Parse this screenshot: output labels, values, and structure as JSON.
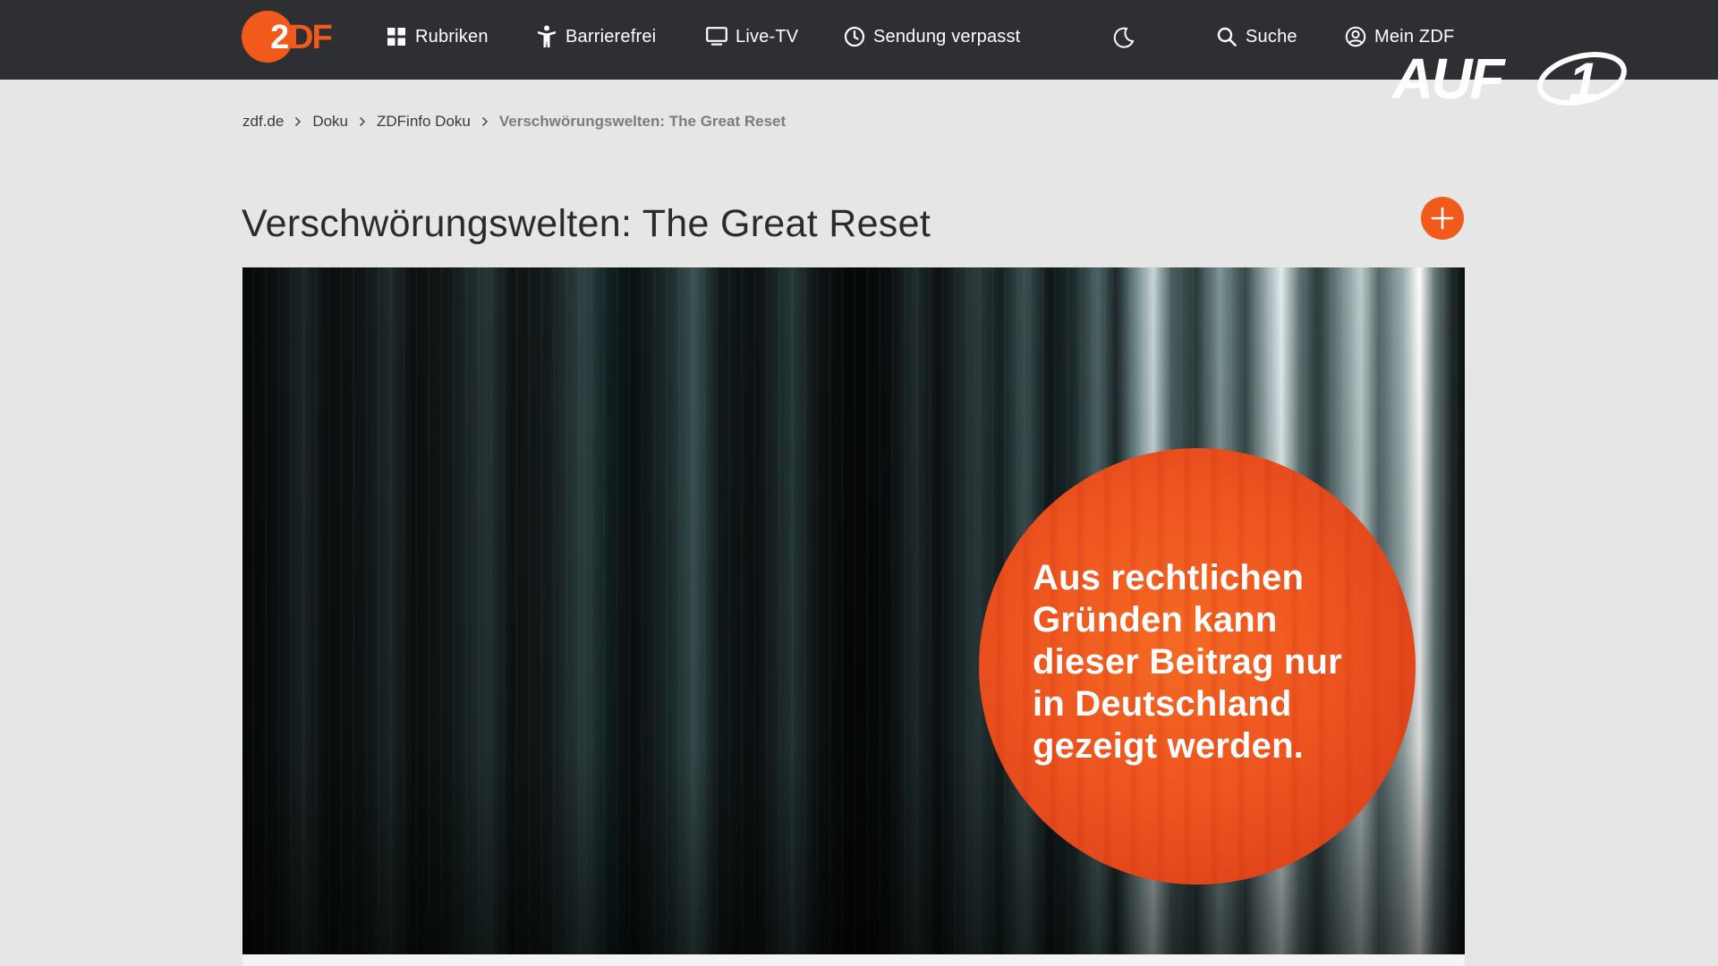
{
  "header": {
    "logo_icon": "zdf-logo-icon",
    "nav": [
      {
        "label": "Rubriken",
        "icon": "grid-icon"
      },
      {
        "label": "Barrierefrei",
        "icon": "accessibility-icon"
      },
      {
        "label": "Live-TV",
        "icon": "tv-icon"
      },
      {
        "label": "Sendung verpasst",
        "icon": "clock-icon"
      }
    ],
    "theme_toggle_icon": "moon-icon",
    "search_label": "Suche",
    "account_label": "Mein ZDF"
  },
  "watermark": {
    "text": "AUF1"
  },
  "breadcrumb": [
    "zdf.de",
    "Doku",
    "ZDFinfo Doku",
    "Verschwörungswelten: The Great Reset"
  ],
  "page": {
    "title": "Verschwörungswelten: The Great Reset",
    "add_icon": "plus-icon"
  },
  "player": {
    "geo_block_lines": [
      "Aus rechtlichen",
      "Gründen kann",
      "dieser Beitrag nur",
      "in Deutschland",
      "gezeigt werden."
    ]
  },
  "colors": {
    "header_bg": "#2d2f33",
    "page_bg": "#e6e6e6",
    "accent_orange": "#f05a1a"
  }
}
